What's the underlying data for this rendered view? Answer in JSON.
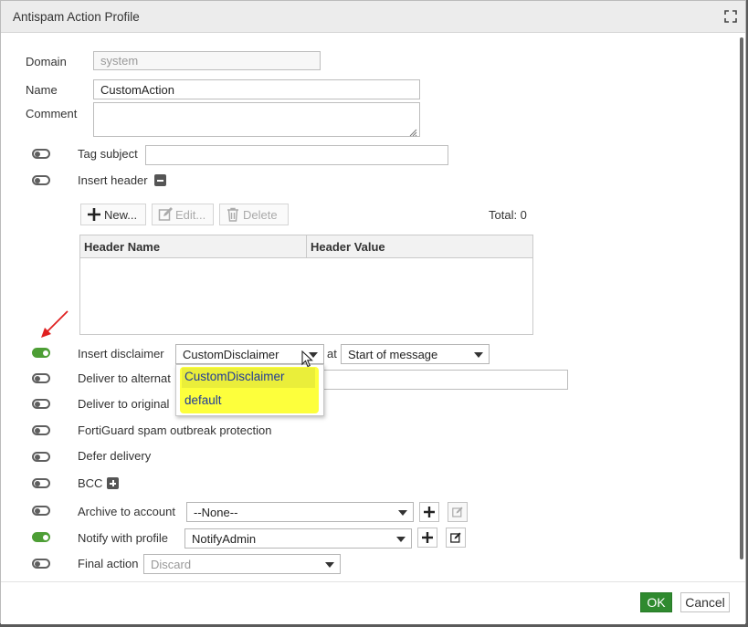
{
  "dialog": {
    "title": "Antispam Action Profile",
    "maximize_icon": "maximize-icon"
  },
  "form": {
    "domain_label": "Domain",
    "domain_value": "system",
    "name_label": "Name",
    "name_value": "CustomAction",
    "comment_label": "Comment",
    "comment_value": ""
  },
  "actions": {
    "tag_subject": {
      "label": "Tag subject",
      "enabled": false,
      "value": ""
    },
    "insert_header": {
      "label": "Insert header",
      "enabled": false,
      "expand_icon": "collapse-icon"
    },
    "insert_disclaimer": {
      "label": "Insert disclaimer",
      "enabled": true,
      "selected": "CustomDisclaimer",
      "at_label": "at",
      "position": "Start of message"
    },
    "deliver_alternate": {
      "label": "Deliver to alternat",
      "enabled": false
    },
    "deliver_original": {
      "label": "Deliver to original",
      "enabled": false
    },
    "fortiguard": {
      "label": "FortiGuard spam outbreak protection",
      "enabled": false
    },
    "defer_delivery": {
      "label": "Defer delivery",
      "enabled": false
    },
    "bcc": {
      "label": "BCC",
      "enabled": false,
      "expand_icon": "expand-icon"
    },
    "archive": {
      "label": "Archive to account",
      "enabled": false,
      "selected": "--None--"
    },
    "notify": {
      "label": "Notify with profile",
      "enabled": true,
      "selected": "NotifyAdmin"
    },
    "final_action": {
      "label": "Final action",
      "enabled": false,
      "selected": "Discard"
    }
  },
  "header_toolbar": {
    "new_label": "New...",
    "edit_label": "Edit...",
    "delete_label": "Delete",
    "total": "Total: 0"
  },
  "header_table": {
    "columns": [
      "Header Name",
      "Header Value"
    ],
    "rows": []
  },
  "disclaimer_dropdown": {
    "options": [
      "CustomDisclaimer",
      "default"
    ],
    "highlighted": "CustomDisclaimer"
  },
  "footer": {
    "ok_label": "OK",
    "cancel_label": "Cancel"
  },
  "colors": {
    "accent": "#4d9e35",
    "ok_button": "#2f8a2f",
    "highlight": "#fdff3c",
    "annotation_arrow": "#e02020"
  }
}
